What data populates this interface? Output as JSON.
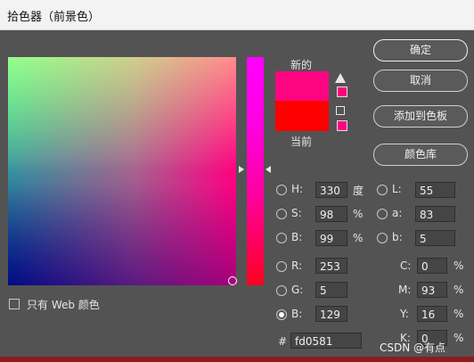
{
  "window": {
    "title": "拾色器（前景色）"
  },
  "labels": {
    "new": "新的",
    "current": "当前"
  },
  "buttons": {
    "ok": "确定",
    "cancel": "取消",
    "add_to_swatches": "添加到色板",
    "color_libraries": "颜色库"
  },
  "hsb": {
    "h": {
      "label": "H:",
      "value": "330",
      "unit": "度"
    },
    "s": {
      "label": "S:",
      "value": "98",
      "unit": "%"
    },
    "b": {
      "label": "B:",
      "value": "99",
      "unit": "%"
    }
  },
  "lab": {
    "l": {
      "label": "L:",
      "value": "55"
    },
    "a": {
      "label": "a:",
      "value": "83"
    },
    "b": {
      "label": "b:",
      "value": "5"
    }
  },
  "rgb": {
    "r": {
      "label": "R:",
      "value": "253"
    },
    "g": {
      "label": "G:",
      "value": "5"
    },
    "b": {
      "label": "B:",
      "value": "129"
    }
  },
  "cmyk": {
    "c": {
      "label": "C:",
      "value": "0",
      "unit": "%"
    },
    "m": {
      "label": "M:",
      "value": "93",
      "unit": "%"
    },
    "y": {
      "label": "Y:",
      "value": "16",
      "unit": "%"
    },
    "k": {
      "label": "K:",
      "value": "0",
      "unit": "%"
    }
  },
  "hex": {
    "label": "#",
    "value": "fd0581"
  },
  "web_only": {
    "label": "只有 Web 颜色",
    "checked": false
  },
  "watermark": "CSDN @有点",
  "colors": {
    "new": "#fd0581",
    "current": "#ff0000",
    "background": "#535353"
  }
}
